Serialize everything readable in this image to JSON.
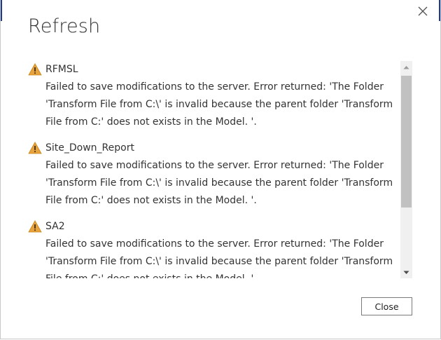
{
  "dialog": {
    "title": "Refresh",
    "close_button_label": "Close"
  },
  "items": [
    {
      "name": "RFMSL",
      "icon": "warning-icon",
      "message": "Failed to save modifications to the server. Error returned: 'The Folder 'Transform File from C:\\' is invalid because the parent folder 'Transform File from C:' does not exists in the Model. '."
    },
    {
      "name": "Site_Down_Report",
      "icon": "warning-icon",
      "message": "Failed to save modifications to the server. Error returned: 'The Folder 'Transform File from C:\\' is invalid because the parent folder 'Transform File from C:' does not exists in the Model. '."
    },
    {
      "name": "SA2",
      "icon": "warning-icon",
      "message": "Failed to save modifications to the server. Error returned: 'The Folder 'Transform File from C:\\' is invalid because the parent folder 'Transform File from C:' does not exists in the Model. '."
    }
  ],
  "colors": {
    "warning_fill": "#e8a33d",
    "scroll_thumb": "#c1c1c1",
    "scroll_track": "#f0f0f0"
  }
}
